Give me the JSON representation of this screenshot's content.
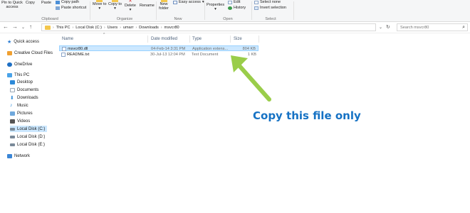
{
  "ribbon": {
    "clipboard": {
      "pin_label": "Pin to Quick access",
      "copy_label": "Copy",
      "paste_label": "Paste",
      "copy_path_label": "Copy path",
      "paste_shortcut_label": "Paste shortcut",
      "group_label": "Clipboard"
    },
    "organize": {
      "move_to_label": "Move to",
      "copy_to_label": "Copy to",
      "delete_label": "Delete",
      "rename_label": "Rename",
      "group_label": "Organize"
    },
    "new": {
      "new_folder_label": "New folder",
      "easy_access_label": "Easy access",
      "group_label": "New"
    },
    "open": {
      "properties_label": "Properties",
      "edit_label": "Edit",
      "history_label": "History",
      "group_label": "Open"
    },
    "select": {
      "select_none_label": "Select none",
      "invert_selection_label": "Invert selection",
      "group_label": "Select"
    }
  },
  "address": {
    "crumbs": [
      "This PC",
      "Local Disk (C:)",
      "Users",
      "umarr",
      "Downloads",
      "msvcr80"
    ],
    "search_placeholder": "Search msvcr80"
  },
  "nav_pane": {
    "items": [
      {
        "label": "Quick access",
        "icon": "star-icon"
      },
      {
        "label": "Creative Cloud Files",
        "icon": "creative-cloud-icon"
      },
      {
        "label": "OneDrive",
        "icon": "cloud-icon"
      },
      {
        "label": "This PC",
        "icon": "computer-icon"
      },
      {
        "label": "Desktop",
        "icon": "desktop-icon"
      },
      {
        "label": "Documents",
        "icon": "documents-icon"
      },
      {
        "label": "Downloads",
        "icon": "downloads-icon"
      },
      {
        "label": "Music",
        "icon": "music-icon"
      },
      {
        "label": "Pictures",
        "icon": "pictures-icon"
      },
      {
        "label": "Videos",
        "icon": "videos-icon"
      },
      {
        "label": "Local Disk (C:)",
        "icon": "drive-icon"
      },
      {
        "label": "Local Disk (D:)",
        "icon": "drive-icon"
      },
      {
        "label": "Local Disk (E:)",
        "icon": "drive-icon"
      },
      {
        "label": "Network",
        "icon": "network-icon"
      }
    ]
  },
  "file_list": {
    "columns": [
      "Name",
      "Date modified",
      "Type",
      "Size"
    ],
    "rows": [
      {
        "name": "msvcr80.dll",
        "date": "04-Feb-14 3:31 PM",
        "type": "Application extens...",
        "size": "804 KB",
        "selected": true
      },
      {
        "name": "README.txt",
        "date": "30-Jul-13 12:04 PM",
        "type": "Text Document",
        "size": "1 KB",
        "selected": false
      }
    ]
  },
  "annotation": {
    "text": "Copy this file only",
    "color": "#1672c4",
    "arrow_color": "#9acd4a"
  },
  "colors": {
    "selection": "#cce8ff",
    "folder": "#f3c64c",
    "accent": "#0078d7"
  }
}
